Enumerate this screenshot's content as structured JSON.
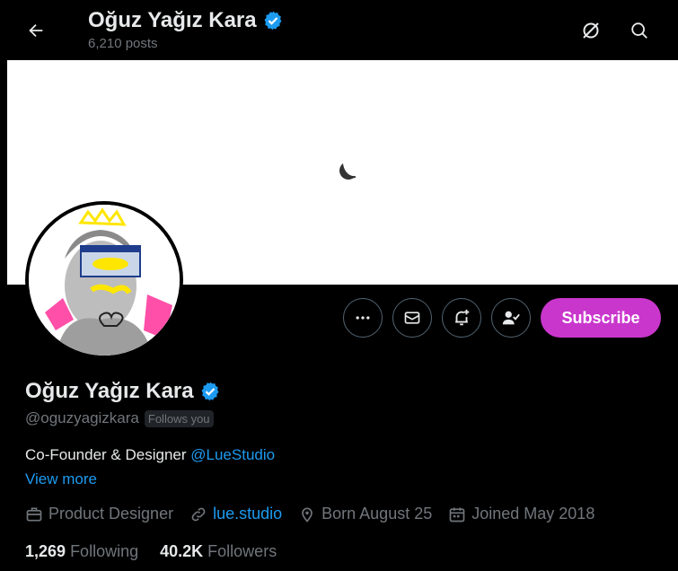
{
  "header": {
    "name": "Oğuz Yağız Kara",
    "posts": "6,210 posts"
  },
  "profile": {
    "name": "Oğuz Yağız Kara",
    "handle": "@oguzyagizkara",
    "follows_you": "Follows you",
    "bio_text": "Co-Founder & Designer ",
    "bio_mention": "@LueStudio",
    "view_more": "View more",
    "category": "Product Designer",
    "website": "lue.studio",
    "born": "Born August 25",
    "joined": "Joined May 2018",
    "following_count": "1,269",
    "following_label": "Following",
    "followers_count": "40.2K",
    "followers_label": "Followers"
  },
  "actions": {
    "subscribe": "Subscribe"
  },
  "icons": [
    "back-arrow-icon",
    "translate-off-icon",
    "search-icon",
    "more-icon",
    "mail-icon",
    "bell-plus-icon",
    "person-check-icon",
    "verified-icon",
    "briefcase-icon",
    "link-icon",
    "location-icon",
    "calendar-icon"
  ],
  "colors": {
    "accent": "#1d9bf0",
    "subscribe": "#c936cc",
    "muted": "#71767b"
  }
}
